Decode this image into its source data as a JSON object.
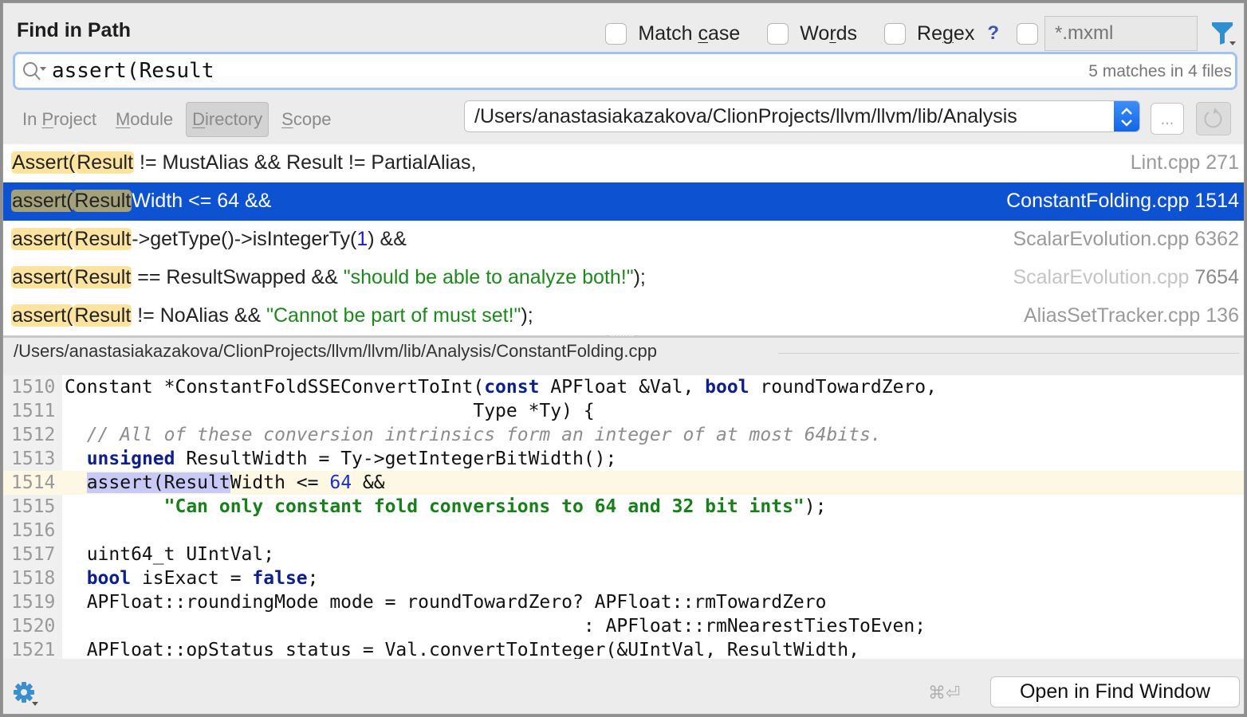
{
  "dialog": {
    "title": "Find in Path"
  },
  "options": {
    "match_case": {
      "label_pre": "Match ",
      "label_u": "c",
      "label_post": "ase",
      "checked": false
    },
    "words": {
      "label_pre": "Wo",
      "label_u": "r",
      "label_post": "ds",
      "checked": false
    },
    "regex": {
      "label_pre": "Re",
      "label_u": "g",
      "label_post": "ex",
      "checked": false
    },
    "regex_help": "?",
    "file_mask": {
      "checked": false,
      "placeholder": "*.mxml"
    },
    "filter_icon": "filter-icon"
  },
  "search": {
    "query": "assert(Result",
    "match_count": "5 matches in 4 files"
  },
  "scopes": [
    {
      "pre": "In ",
      "u": "P",
      "post": "roject",
      "active": false
    },
    {
      "pre": "",
      "u": "M",
      "post": "odule",
      "active": false
    },
    {
      "pre": "",
      "u": "D",
      "post": "irectory",
      "active": true
    },
    {
      "pre": "",
      "u": "S",
      "post": "cope",
      "active": false
    }
  ],
  "directory": {
    "value": "/Users/anastasiakazakova/ClionProjects/llvm/llvm/lib/Analysis",
    "browse_label": "..."
  },
  "results": [
    {
      "m1": "Assert(",
      "m2": "Result",
      "rest": [
        {
          "t": " != MustAlias && Result != PartialAlias,",
          "c": ""
        }
      ],
      "file": "Lint.cpp",
      "line": "271",
      "selected": false,
      "dim": false
    },
    {
      "m1": "assert(",
      "m2": "Result",
      "rest": [
        {
          "t": "Width <= 64 &&",
          "c": ""
        }
      ],
      "file": "ConstantFolding.cpp",
      "line": "1514",
      "selected": true,
      "dim": false
    },
    {
      "m1": "assert(",
      "m2": "Result",
      "rest": [
        {
          "t": "->getType()->isIntegerTy(",
          "c": ""
        },
        {
          "t": "1",
          "c": "num"
        },
        {
          "t": ") &&",
          "c": ""
        }
      ],
      "file": "ScalarEvolution.cpp",
      "line": "6362",
      "selected": false,
      "dim": false
    },
    {
      "m1": "assert(",
      "m2": "Result",
      "rest": [
        {
          "t": " == ResultSwapped && ",
          "c": ""
        },
        {
          "t": "\"should be able to analyze both!\"",
          "c": "str"
        },
        {
          "t": ");",
          "c": ""
        }
      ],
      "file": "ScalarEvolution.cpp",
      "line": "7654",
      "selected": false,
      "dim": true
    },
    {
      "m1": "assert(",
      "m2": "Result",
      "rest": [
        {
          "t": " != NoAlias && ",
          "c": ""
        },
        {
          "t": "\"Cannot be part of must set!\"",
          "c": "str"
        },
        {
          "t": ");",
          "c": ""
        }
      ],
      "file": "AliasSetTracker.cpp",
      "line": "136",
      "selected": false,
      "dim": false
    }
  ],
  "preview": {
    "path": "/Users/anastasiakazakova/ClionProjects/llvm/llvm/lib/Analysis/ConstantFolding.cpp",
    "current_line": "1514",
    "lines": [
      {
        "n": "1510",
        "tokens": [
          {
            "t": "Constant *ConstantFoldSSEConvertToInt(",
            "c": ""
          },
          {
            "t": "const",
            "c": "kw"
          },
          {
            "t": " APFloat &Val, ",
            "c": ""
          },
          {
            "t": "bool",
            "c": "kw"
          },
          {
            "t": " roundTowardZero,",
            "c": ""
          }
        ]
      },
      {
        "n": "1511",
        "tokens": [
          {
            "t": "                                     Type *Ty) {",
            "c": ""
          }
        ]
      },
      {
        "n": "1512",
        "tokens": [
          {
            "t": "  ",
            "c": ""
          },
          {
            "t": "// All of these conversion intrinsics form an integer of at most 64bits.",
            "c": "cmt"
          }
        ]
      },
      {
        "n": "1513",
        "tokens": [
          {
            "t": "  ",
            "c": ""
          },
          {
            "t": "unsigned",
            "c": "kw"
          },
          {
            "t": " ResultWidth = Ty->getIntegerBitWidth();",
            "c": ""
          }
        ]
      },
      {
        "n": "1514",
        "tokens": [
          {
            "t": "  ",
            "c": ""
          },
          {
            "t": "assert(Result",
            "c": "mhl"
          },
          {
            "t": "Width <= ",
            "c": ""
          },
          {
            "t": "64",
            "c": "cnum"
          },
          {
            "t": " &&",
            "c": ""
          }
        ]
      },
      {
        "n": "1515",
        "tokens": [
          {
            "t": "         ",
            "c": ""
          },
          {
            "t": "\"Can only constant fold conversions to 64 and 32 bit ints\"",
            "c": "cstr"
          },
          {
            "t": ");",
            "c": ""
          }
        ]
      },
      {
        "n": "1516",
        "tokens": []
      },
      {
        "n": "1517",
        "tokens": [
          {
            "t": "  uint64_t UIntVal;",
            "c": ""
          }
        ]
      },
      {
        "n": "1518",
        "tokens": [
          {
            "t": "  ",
            "c": ""
          },
          {
            "t": "bool",
            "c": "kw"
          },
          {
            "t": " isExact = ",
            "c": ""
          },
          {
            "t": "false",
            "c": "kw"
          },
          {
            "t": ";",
            "c": ""
          }
        ]
      },
      {
        "n": "1519",
        "tokens": [
          {
            "t": "  APFloat::roundingMode mode = roundTowardZero? APFloat::rmTowardZero",
            "c": ""
          }
        ]
      },
      {
        "n": "1520",
        "tokens": [
          {
            "t": "                                               : APFloat::rmNearestTiesToEven;",
            "c": ""
          }
        ]
      },
      {
        "n": "1521",
        "tokens": [
          {
            "t": "  APFloat::opStatus status = Val.convertToInteger(&UIntVal, ResultWidth,",
            "c": ""
          }
        ]
      }
    ]
  },
  "footer": {
    "settings_icon": "gear-icon",
    "shortcut": "⌘⏎",
    "open_button": "Open in Find Window"
  }
}
